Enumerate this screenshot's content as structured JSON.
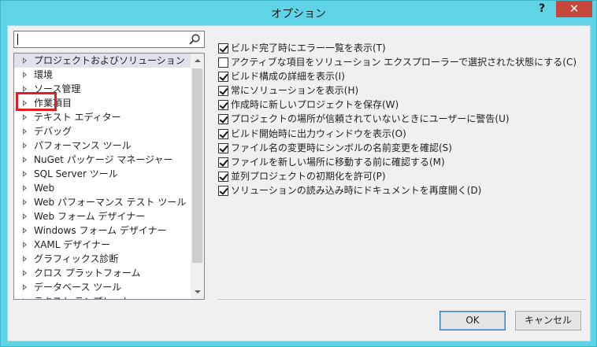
{
  "window": {
    "title": "オプション",
    "help_label": "?",
    "close_label": "✕"
  },
  "search": {
    "value": "",
    "icon": "search-icon"
  },
  "tree": {
    "items": [
      {
        "label": "プロジェクトおよびソリューション",
        "selected": true
      },
      {
        "label": "環境"
      },
      {
        "label": "ソース管理"
      },
      {
        "label": "作業項目"
      },
      {
        "label": "テキスト エディター"
      },
      {
        "label": "デバッグ"
      },
      {
        "label": "パフォーマンス ツール"
      },
      {
        "label": "NuGet パッケージ マネージャー"
      },
      {
        "label": "SQL Server ツール"
      },
      {
        "label": "Web"
      },
      {
        "label": "Web パフォーマンス テスト ツール"
      },
      {
        "label": "Web フォーム デザイナー"
      },
      {
        "label": "Windows フォーム デザイナー"
      },
      {
        "label": "XAML デザイナー"
      },
      {
        "label": "グラフィックス診断"
      },
      {
        "label": "クロス プラットフォーム"
      },
      {
        "label": "データベース ツール"
      },
      {
        "label": "テキスト テンプレート"
      }
    ]
  },
  "options": [
    {
      "label": "ビルド完了時にエラー一覧を表示(T)",
      "checked": true
    },
    {
      "label": "アクティブな項目をソリューション エクスプローラーで選択された状態にする(C)",
      "checked": false
    },
    {
      "label": "ビルド構成の詳細を表示(I)",
      "checked": true
    },
    {
      "label": "常にソリューションを表示(H)",
      "checked": true
    },
    {
      "label": "作成時に新しいプロジェクトを保存(W)",
      "checked": true
    },
    {
      "label": "プロジェクトの場所が信頼されていないときにユーザーに警告(U)",
      "checked": true
    },
    {
      "label": "ビルド開始時に出力ウィンドウを表示(O)",
      "checked": true
    },
    {
      "label": "ファイル名の変更時にシンボルの名前変更を確認(S)",
      "checked": true
    },
    {
      "label": "ファイルを新しい場所に移動する前に確認する(M)",
      "checked": true
    },
    {
      "label": "並列プロジェクトの初期化を許可(P)",
      "checked": true
    },
    {
      "label": "ソリューションの読み込み時にドキュメントを再度開く(D)",
      "checked": true
    }
  ],
  "buttons": {
    "ok_label": "OK",
    "cancel_label": "キャンセル"
  },
  "colors": {
    "title_bar": "#5fd4e6",
    "close_button": "#c7463b",
    "highlight_box": "#e21d24"
  }
}
